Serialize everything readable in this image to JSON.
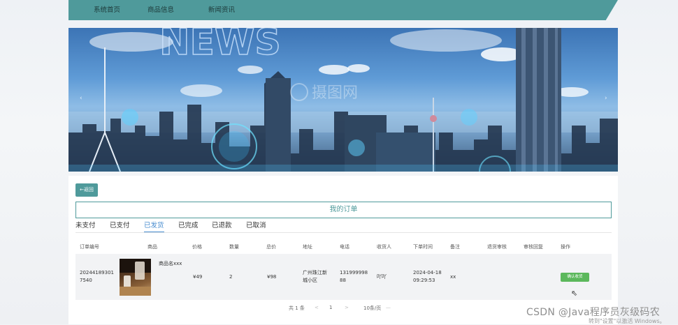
{
  "nav": {
    "items": [
      {
        "label": "系统首页"
      },
      {
        "label": "商品信息"
      },
      {
        "label": "新闻资讯"
      }
    ]
  },
  "banner": {
    "headline_text": "NEWS",
    "watermark_text": "摄图网",
    "prev_icon": "chevron-left-icon",
    "next_icon": "chevron-right-icon"
  },
  "order": {
    "back_label": "←返回",
    "title": "我的订单",
    "tabs": [
      "未支付",
      "已支付",
      "已发货",
      "已完成",
      "已退款",
      "已取消"
    ],
    "active_tab": "已发货",
    "columns": [
      "订单编号",
      "商品",
      "价格",
      "数量",
      "总价",
      "地址",
      "电话",
      "收货人",
      "下单时间",
      "备注",
      "退货审核",
      "审核回复",
      "操作"
    ],
    "row": {
      "order_no_line1": "20244189301",
      "order_no_line2": "7540",
      "product_name": "商品名xxx",
      "price": "¥49",
      "quantity": "2",
      "total": "¥98",
      "address_line1": "广州珠江新",
      "address_line2": "城小区",
      "phone_line1": "131999998",
      "phone_line2": "88",
      "receiver": "吖吖",
      "time_line1": "2024-04-18",
      "time_line2": "09:29:53",
      "remark": "xx",
      "action_label": "确认收货"
    },
    "pagination": {
      "total": "共 1 条",
      "prev": "<",
      "page": "1",
      "next": ">",
      "page_size": "10条/页",
      "jump": "—"
    }
  },
  "overlay": {
    "watermark": "CSDN @Java程序员灰级码农",
    "windows_text": "转到\"设置\"以激活 Windows。"
  },
  "colors": {
    "accent": "#4f9a9b",
    "active_tab": "#4a8ed0",
    "confirm": "#5cb85c"
  }
}
